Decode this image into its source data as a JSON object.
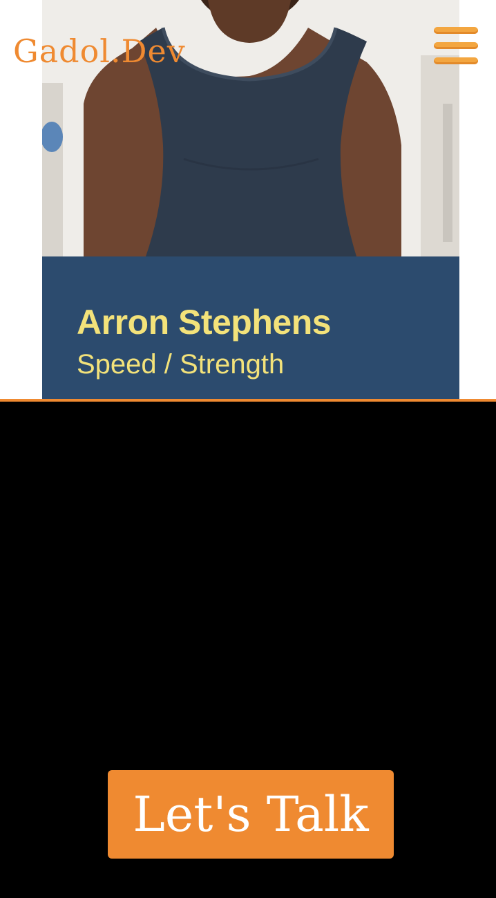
{
  "header": {
    "brand": "Gadol.Dev",
    "menu_icon": "hamburger-menu-icon"
  },
  "trainer": {
    "name": "Arron Stephens",
    "specialty": "Speed / Strength"
  },
  "cta": {
    "label": "Let's Talk"
  },
  "colors": {
    "accent": "#ef8a31",
    "caption_background": "#2c4b6e",
    "caption_text": "#f3e27a",
    "bottom_background": "#000000"
  }
}
